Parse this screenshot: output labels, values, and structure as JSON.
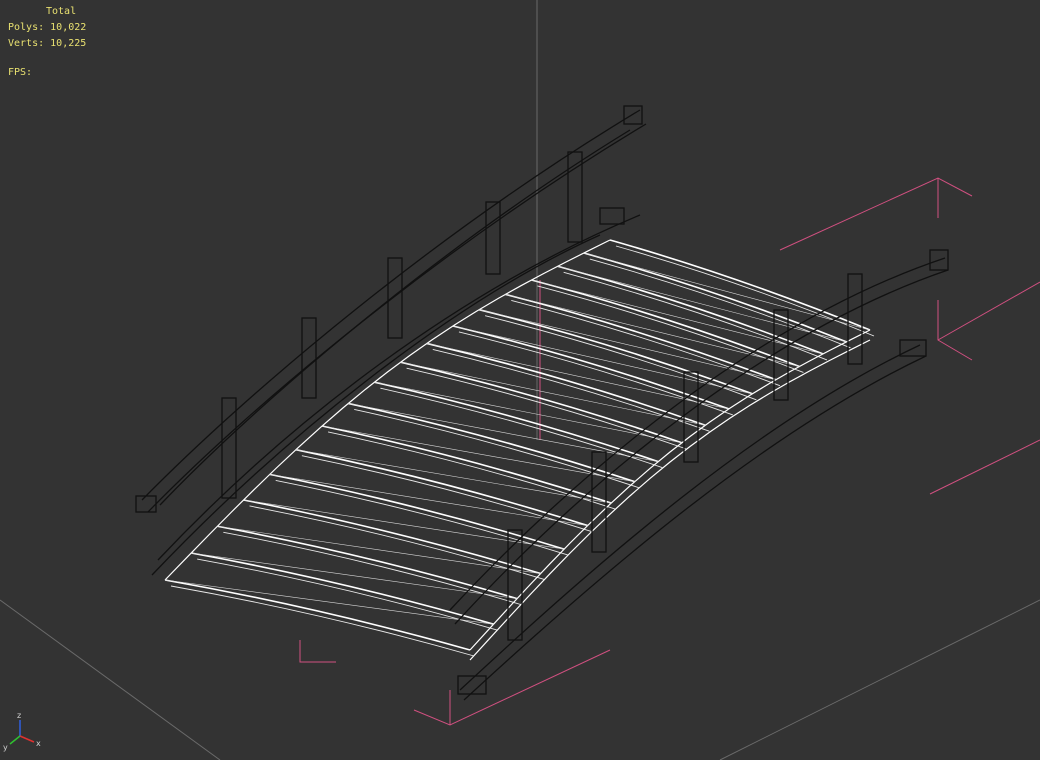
{
  "stats": {
    "title": "Total",
    "polys_label": "Polys:",
    "polys_value": "10,022",
    "verts_label": "Verts:",
    "verts_value": "10,225",
    "fps_label": "FPS:"
  },
  "axis_gizmo": {
    "z_label": "z",
    "x_label": "x",
    "y_label": "y",
    "colors": {
      "x": "#e03030",
      "y": "#30c030",
      "z": "#3060e0"
    }
  },
  "colors": {
    "background": "#333333",
    "text": "#e8e070",
    "grid": "#6a6a6a",
    "bounding_box": "#d05080",
    "wire_deck": "#ffffff",
    "wire_frame": "#111111"
  }
}
